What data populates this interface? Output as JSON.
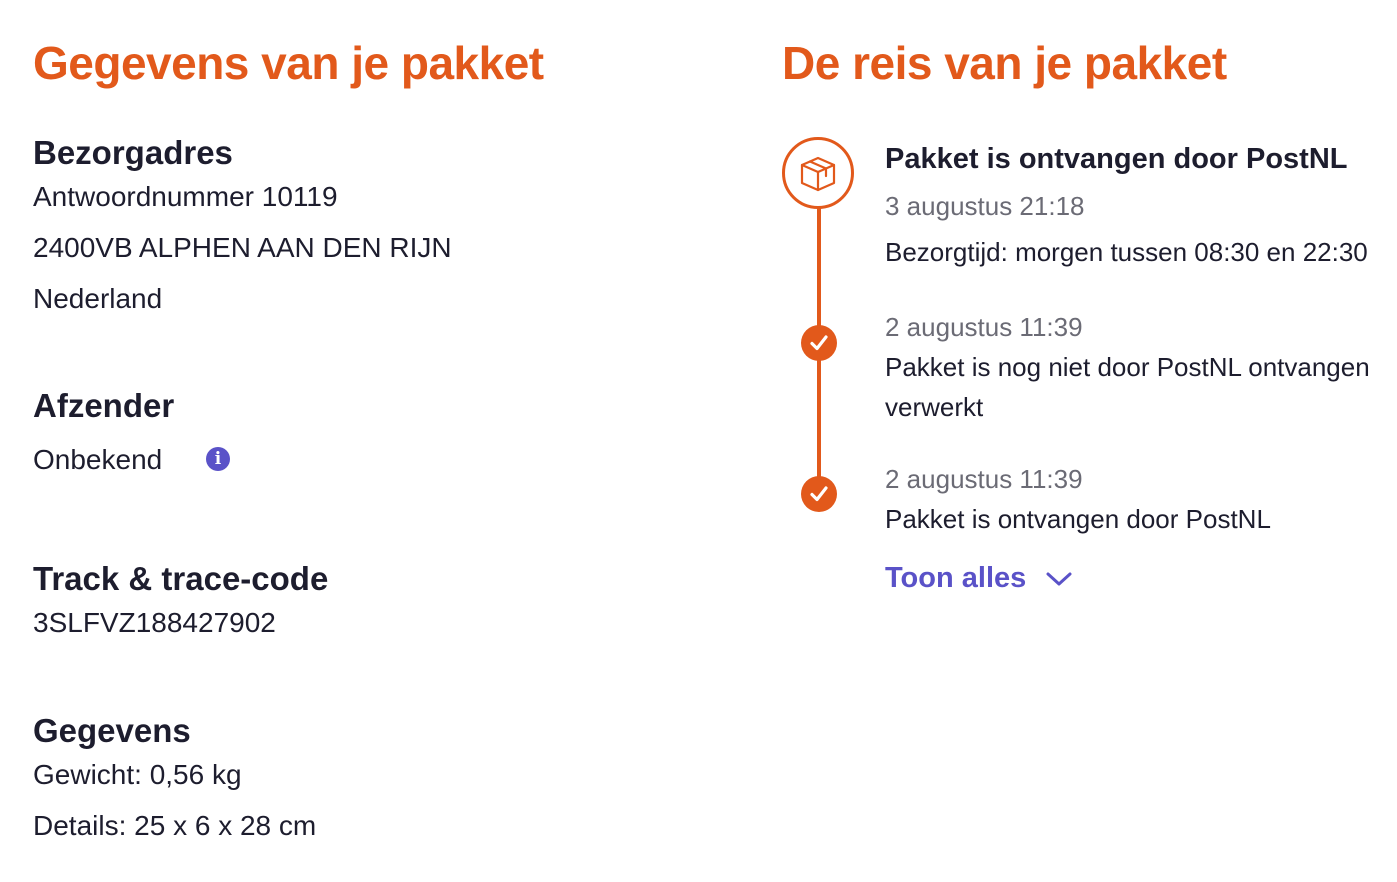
{
  "details": {
    "heading": "Gegevens van je pakket",
    "address": {
      "title": "Bezorgadres",
      "line1": "Antwoordnummer 10119",
      "line2": "2400VB ALPHEN AAN DEN RIJN",
      "line3": "Nederland"
    },
    "sender": {
      "title": "Afzender",
      "value": "Onbekend",
      "info_icon": "info-icon"
    },
    "tracking": {
      "title": "Track & trace-code",
      "code": "3SLFVZ188427902"
    },
    "info": {
      "title": "Gegevens",
      "weight": "Gewicht: 0,56 kg",
      "size": "Details: 25 x 6 x 28 cm"
    }
  },
  "journey": {
    "heading": "De reis van je pakket",
    "events": [
      {
        "icon": "package-icon",
        "title": "Pakket is ontvangen door PostNL",
        "time": "3 augustus 21:18",
        "text": "Bezorgtijd: morgen tussen 08:30 en 22:30"
      },
      {
        "icon": "check-icon",
        "time": "2 augustus 11:39",
        "text_line1": "Pakket is nog niet door PostNL ontvangen",
        "text_line2": "verwerkt"
      },
      {
        "icon": "check-icon",
        "time": "2 augustus 11:39",
        "text": "Pakket is ontvangen door PostNL"
      }
    ],
    "show_all_label": "Toon alles",
    "show_all_icon": "chevron-down-icon"
  },
  "colors": {
    "accent": "#e2591b",
    "link": "#5a52c8",
    "text": "#1d1d2e",
    "muted": "#6b6b75"
  }
}
